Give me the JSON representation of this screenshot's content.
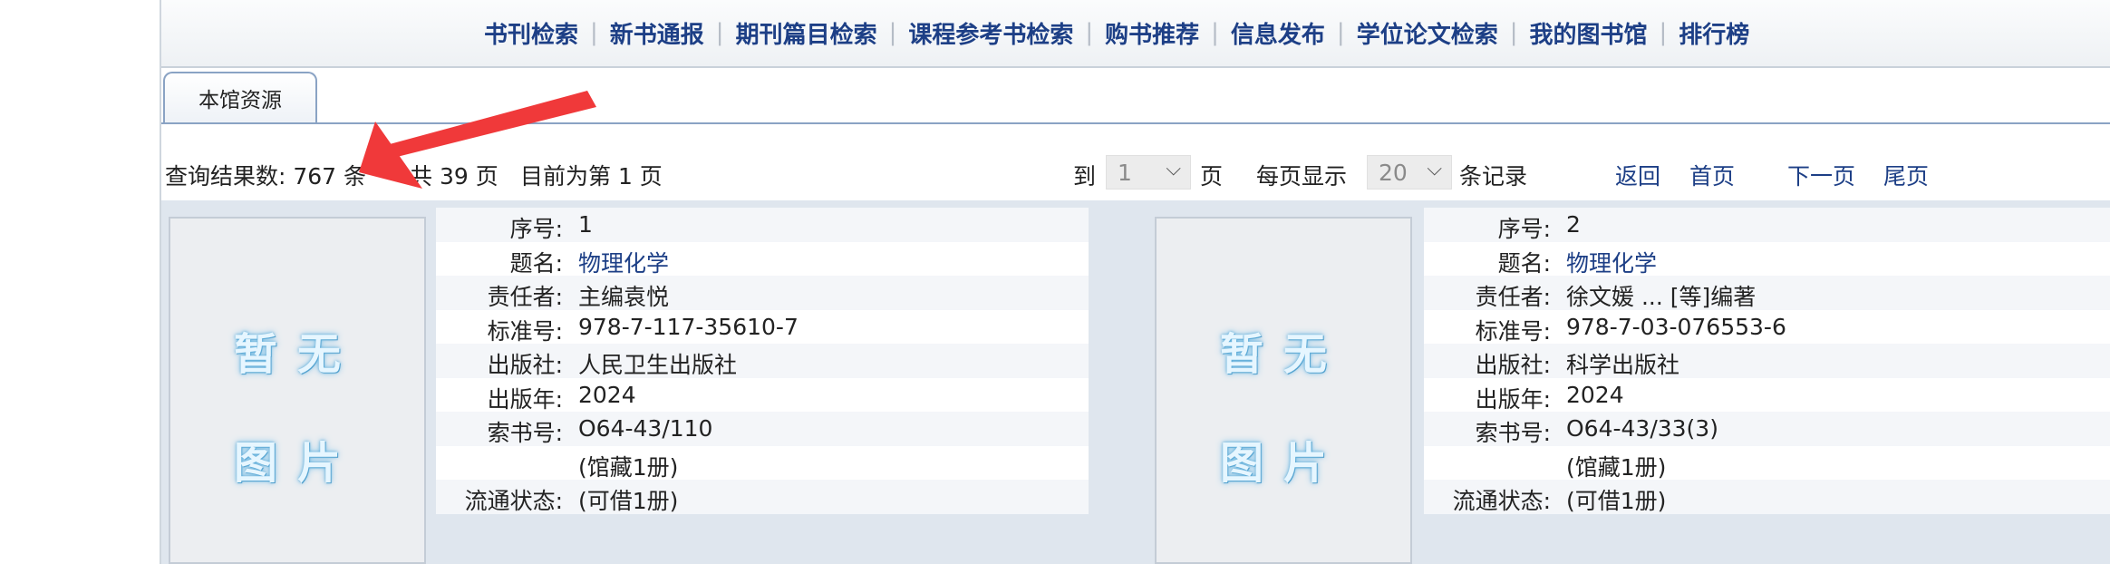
{
  "nav": {
    "items": [
      "书刊检索",
      "新书通报",
      "期刊篇目检索",
      "课程参考书检索",
      "购书推荐",
      "信息发布",
      "学位论文检索",
      "我的图书馆",
      "排行榜"
    ]
  },
  "tab": {
    "label": "本馆资源"
  },
  "results": {
    "count_text": "查询结果数: 767 条",
    "pages_text": "共 39 页",
    "current_text": "目前为第 1 页",
    "goto_label": "到",
    "goto_value": "1",
    "goto_unit": "页",
    "per_page_label": "每页显示",
    "per_page_value": "20",
    "per_page_unit": "条记录",
    "back": "返回",
    "first": "首页",
    "next": "下一页",
    "last": "尾页"
  },
  "cover": {
    "line1": "暂无",
    "line2": "图片"
  },
  "records": [
    {
      "labels": [
        "序号:",
        "题名:",
        "责任者:",
        "标准号:",
        "出版社:",
        "出版年:",
        "索书号:",
        "",
        "流通状态:"
      ],
      "values": [
        "1",
        "物理化学",
        "主编袁悦",
        "978-7-117-35610-7",
        "人民卫生出版社",
        "2024",
        "O64-43/110",
        "(馆藏1册)",
        "(可借1册)"
      ]
    },
    {
      "labels": [
        "序号:",
        "题名:",
        "责任者:",
        "标准号:",
        "出版社:",
        "出版年:",
        "索书号:",
        "",
        "流通状态:"
      ],
      "values": [
        "2",
        "物理化学",
        "徐文媛 ... [等]编著",
        "978-7-03-076553-6",
        "科学出版社",
        "2024",
        "O64-43/33(3)",
        "(馆藏1册)",
        "(可借1册)"
      ]
    }
  ],
  "colors": {
    "nav_link": "#1d3f86",
    "arrow": "#f0393a",
    "record_bg": "#dfe6ee"
  }
}
